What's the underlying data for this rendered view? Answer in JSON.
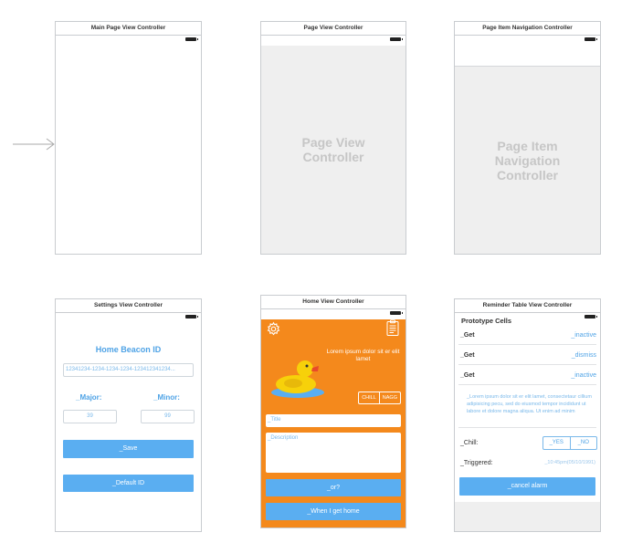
{
  "colors": {
    "accent": "#5aaef1",
    "home_background": "#f4891c",
    "placeholder_text": "#c6c6c6",
    "scene_border": "#c9ccd0"
  },
  "scenes": {
    "main": {
      "title": "Main Page View Controller"
    },
    "page": {
      "title": "Page View Controller",
      "placeholder": "Page View Controller"
    },
    "item_nav": {
      "title": "Page Item Navigation Controller",
      "placeholder": "Page Item Navigation Controller"
    },
    "settings": {
      "title": "Settings View Controller",
      "heading": "Home Beacon ID",
      "beacon_id": "12341234-1234-1234-1234-123412341234...",
      "major_label": "_Major:",
      "minor_label": "_Minor:",
      "major_value": "39",
      "minor_value": "99",
      "save_label": "_Save",
      "default_id_label": "_Default ID"
    },
    "home": {
      "title": "Home View Controller",
      "lorem": "Lorem ipsum dolor sit er elit lamet",
      "chill_label": "CHILL",
      "nagg_label": "NAGG",
      "title_placeholder": "_Title",
      "description_placeholder": "_Description",
      "or_label": "_or?",
      "when_home_label": "_When I get home",
      "settings_icon": "gear-icon",
      "clipboard_icon": "clipboard-icon"
    },
    "reminder": {
      "title": "Reminder Table View Controller",
      "section_header": "Prototype Cells",
      "rows": [
        {
          "label": "_Get",
          "value": "_inactive"
        },
        {
          "label": "_Get",
          "value": "_dismiss"
        },
        {
          "label": "_Get",
          "value": "_inactive"
        }
      ],
      "lorem": "_Lorem ipsum dolor sit er elit lamet, consectetaur cillium adipisicing pecu, sed do eiusmod tempor incididunt ut labore et dolore magna aliqua. Ut enim ad minim",
      "chill_label": "_Chill:",
      "yes_label": "_YES",
      "no_label": "_NO",
      "triggered_label": "_Triggered:",
      "triggered_value": "_10:45pm(05/10/1991)",
      "cancel_label": "_cancel alarm"
    }
  }
}
